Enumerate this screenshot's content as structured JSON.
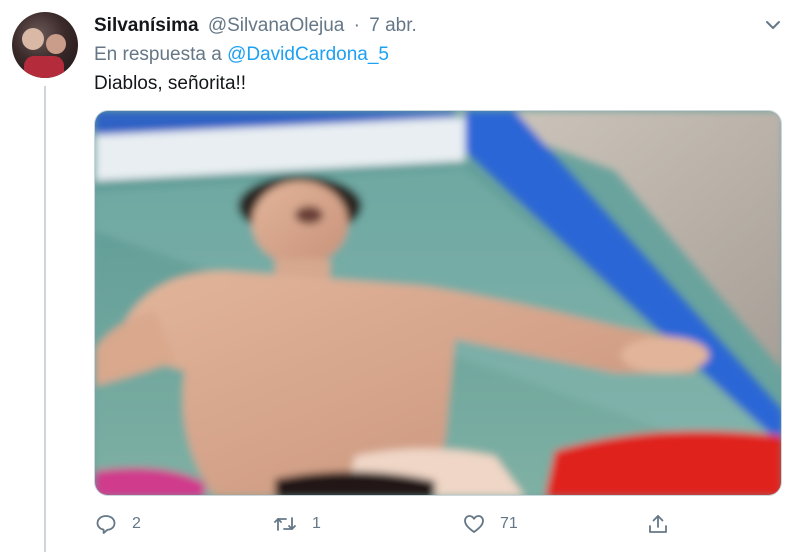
{
  "tweet": {
    "display_name": "Silvanísima",
    "handle": "@SilvanaOlejua",
    "separator": "·",
    "date": "7 abr.",
    "reply_prefix": "En respuesta a",
    "reply_handle": "@DavidCardona_5",
    "text": "Diablos, señorita!!"
  },
  "actions": {
    "replies": "2",
    "retweets": "1",
    "likes": "71"
  },
  "colors": {
    "link": "#1da1f2",
    "secondary_text": "#657786",
    "primary_text": "#14171a",
    "thread_line": "#ccd6dd"
  },
  "icons": [
    "caret-down-icon",
    "reply-icon",
    "retweet-icon",
    "like-icon",
    "share-icon"
  ]
}
